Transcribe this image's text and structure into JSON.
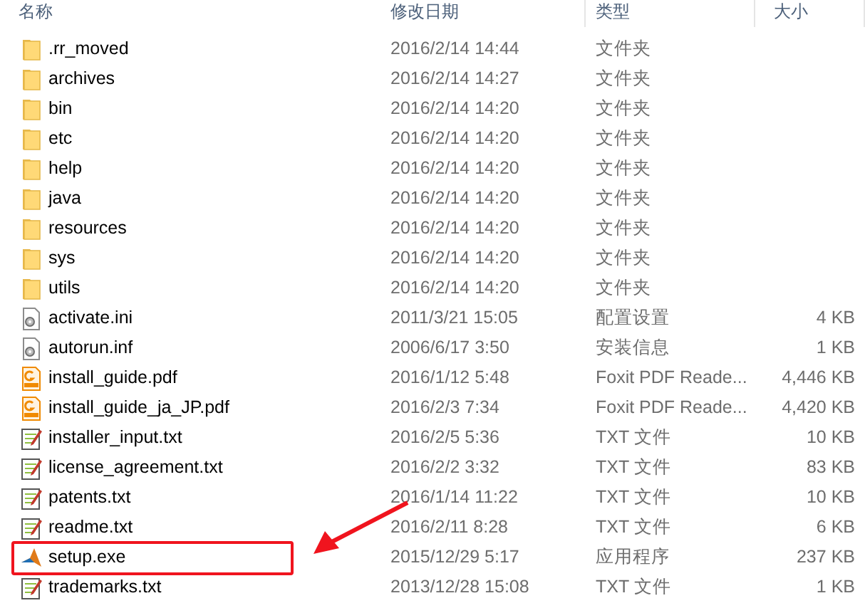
{
  "columns": [
    "名称",
    "修改日期",
    "类型",
    "大小"
  ],
  "rows": [
    {
      "kind": "folder",
      "name": ".rr_moved",
      "date": "2016/2/14 14:44",
      "type": "文件夹",
      "highlighted": false
    },
    {
      "kind": "folder",
      "name": "archives",
      "date": "2016/2/14 14:27",
      "type": "文件夹",
      "highlighted": false
    },
    {
      "kind": "folder",
      "name": "bin",
      "date": "2016/2/14 14:20",
      "type": "文件夹",
      "highlighted": false
    },
    {
      "kind": "folder",
      "name": "etc",
      "date": "2016/2/14 14:20",
      "type": "文件夹",
      "highlighted": false
    },
    {
      "kind": "folder",
      "name": "help",
      "date": "2016/2/14 14:20",
      "type": "文件夹",
      "highlighted": false
    },
    {
      "kind": "folder",
      "name": "java",
      "date": "2016/2/14 14:20",
      "type": "文件夹",
      "highlighted": false
    },
    {
      "kind": "folder",
      "name": "resources",
      "date": "2016/2/14 14:20",
      "type": "文件夹",
      "highlighted": false
    },
    {
      "kind": "folder",
      "name": "sys",
      "date": "2016/2/14 14:20",
      "type": "文件夹",
      "highlighted": false
    },
    {
      "kind": "folder",
      "name": "utils",
      "date": "2016/2/14 14:20",
      "type": "文件夹",
      "highlighted": false
    },
    {
      "kind": "config",
      "name": "activate.ini",
      "date": "2011/3/21 15:05",
      "type": "配置设置",
      "size": "4 KB",
      "highlighted": false
    },
    {
      "kind": "config",
      "name": "autorun.inf",
      "date": "2006/6/17 3:50",
      "type": "安装信息",
      "size": "1 KB",
      "highlighted": false
    },
    {
      "kind": "pdf",
      "name": "install_guide.pdf",
      "date": "2016/1/12 5:48",
      "type": "Foxit PDF Reade...",
      "size": "4,446 KB",
      "highlighted": false
    },
    {
      "kind": "pdf",
      "name": "install_guide_ja_JP.pdf",
      "date": "2016/2/3 7:34",
      "type": "Foxit PDF Reade...",
      "size": "4,420 KB",
      "highlighted": false
    },
    {
      "kind": "txt",
      "name": "installer_input.txt",
      "date": "2016/2/5 5:36",
      "type": "TXT 文件",
      "size": "10 KB",
      "highlighted": false
    },
    {
      "kind": "txt",
      "name": "license_agreement.txt",
      "date": "2016/2/2 3:32",
      "type": "TXT 文件",
      "size": "83 KB",
      "highlighted": false
    },
    {
      "kind": "txt",
      "name": "patents.txt",
      "date": "2016/1/14 11:22",
      "type": "TXT 文件",
      "size": "10 KB",
      "highlighted": false
    },
    {
      "kind": "txt",
      "name": "readme.txt",
      "date": "2016/2/11 8:28",
      "type": "TXT 文件",
      "size": "6 KB",
      "highlighted": false
    },
    {
      "kind": "exe",
      "name": "setup.exe",
      "date": "2015/12/29 5:17",
      "type": "应用程序",
      "size": "237 KB",
      "highlighted": true
    },
    {
      "kind": "txt",
      "name": "trademarks.txt",
      "date": "2013/12/28 15:08",
      "type": "TXT 文件",
      "size": "1 KB",
      "highlighted": false
    }
  ]
}
